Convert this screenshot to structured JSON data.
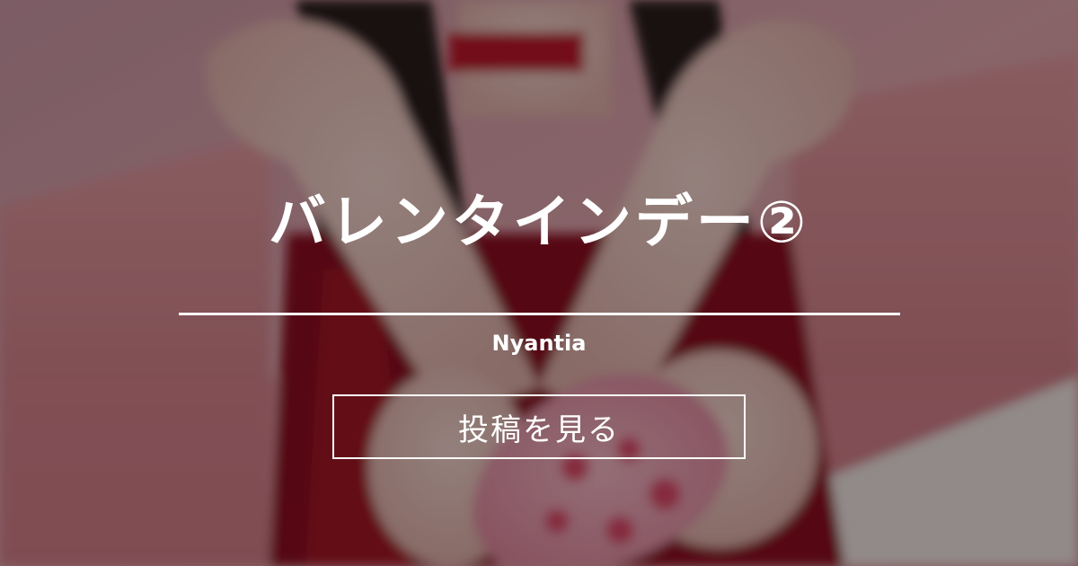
{
  "card": {
    "title": "バレンタインデー②",
    "author": "Nyantia",
    "cta_label": "投稿を見る"
  },
  "colors": {
    "text": "#ffffff",
    "overlay": "rgba(0,0,0,0.40)",
    "background_pink": "#d99aa3",
    "dress_red": "#8e1020"
  }
}
